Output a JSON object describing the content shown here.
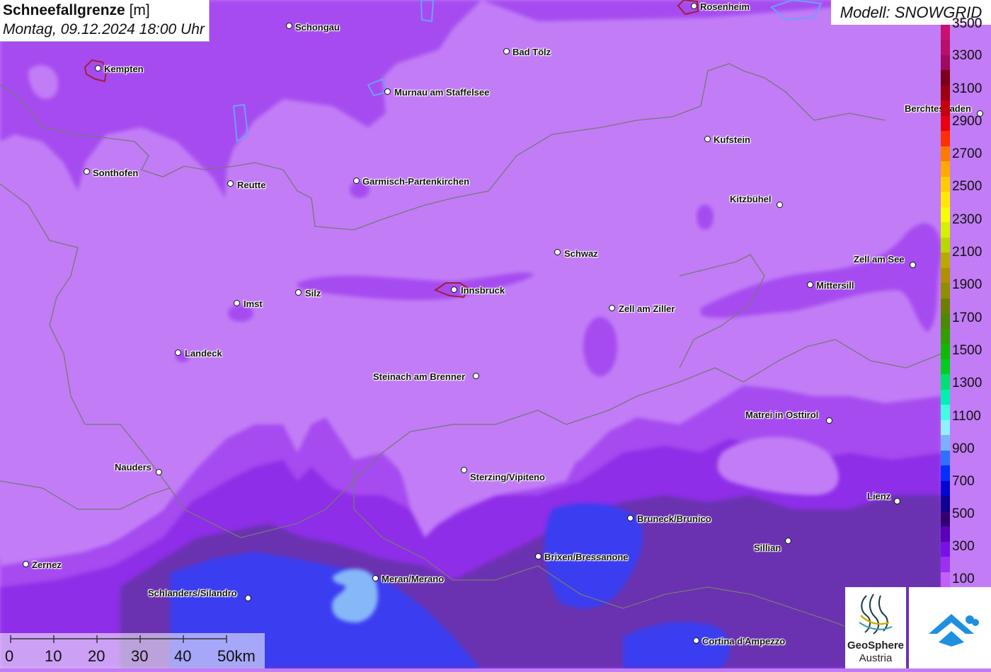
{
  "title": {
    "main": "Schneefallgrenze",
    "unit": "[m]",
    "datetime": "Montag, 09.12.2024 18:00 Uhr"
  },
  "model": "Modell: SNOWGRID",
  "cities": [
    {
      "name": "Rosenheim"
    },
    {
      "name": "Schongau"
    },
    {
      "name": "Kempten"
    },
    {
      "name": "Bad Tölz"
    },
    {
      "name": "Murnau am Staffelsee"
    },
    {
      "name": "Berchtesgaden"
    },
    {
      "name": "Kufstein"
    },
    {
      "name": "Sonthofen"
    },
    {
      "name": "Reutte"
    },
    {
      "name": "Garmisch-Partenkirchen"
    },
    {
      "name": "Kitzbühel"
    },
    {
      "name": "Schwaz"
    },
    {
      "name": "Zell am See"
    },
    {
      "name": "Mittersill"
    },
    {
      "name": "Innsbruck"
    },
    {
      "name": "Silz"
    },
    {
      "name": "Imst"
    },
    {
      "name": "Zell am Ziller"
    },
    {
      "name": "Landeck"
    },
    {
      "name": "Steinach am Brenner"
    },
    {
      "name": "Matrei in Osttirol"
    },
    {
      "name": "Nauders"
    },
    {
      "name": "Sterzing/Vipiteno"
    },
    {
      "name": "Lienz"
    },
    {
      "name": "Bruneck/Brunico"
    },
    {
      "name": "Sillian"
    },
    {
      "name": "Brixen/Bressanone"
    },
    {
      "name": "Zernez"
    },
    {
      "name": "Meran/Merano"
    },
    {
      "name": "Schlanders/Silandro"
    },
    {
      "name": "Cortina d'Ampezzo"
    }
  ],
  "legend": {
    "labels": [
      "3500",
      "3300",
      "3100",
      "2900",
      "2700",
      "2500",
      "2300",
      "2100",
      "1900",
      "1700",
      "1500",
      "1300",
      "1100",
      "900",
      "700",
      "500",
      "300",
      "100"
    ],
    "colors": [
      "#c8106e",
      "#b8106a",
      "#a00a60",
      "#7a0018",
      "#9a0010",
      "#c40010",
      "#e80010",
      "#ff3000",
      "#ff7a00",
      "#ffaa00",
      "#ffcc00",
      "#ffe800",
      "#f5ff00",
      "#d6f000",
      "#b8d800",
      "#b8a800",
      "#b09000",
      "#8e8e00",
      "#6e7e00",
      "#4a8a00",
      "#30a000",
      "#10b800",
      "#00cc20",
      "#00e070",
      "#00f0b0",
      "#40ffe0",
      "#90f0ff",
      "#7ab0ff",
      "#3070ff",
      "#0030ff",
      "#0008d0",
      "#100090",
      "#30006e",
      "#5a00b8",
      "#7a10e8",
      "#9a30f0",
      "#c060f8"
    ]
  },
  "scale": {
    "ticks": [
      "0",
      "10",
      "20",
      "30",
      "40",
      "50km"
    ]
  },
  "logos": {
    "geosphere_line1": "GeoSphere",
    "geosphere_line2": "Austria"
  },
  "colors": {
    "background": "#c27df6",
    "purple": "#a64cf0",
    "magenta_deep": "#8e2ee8",
    "violet": "#7a3ee0",
    "dark_purple": "#6a33b0",
    "blue": "#3a3cf0",
    "light_blue": "#86b8f8",
    "border_line": "#777777"
  }
}
